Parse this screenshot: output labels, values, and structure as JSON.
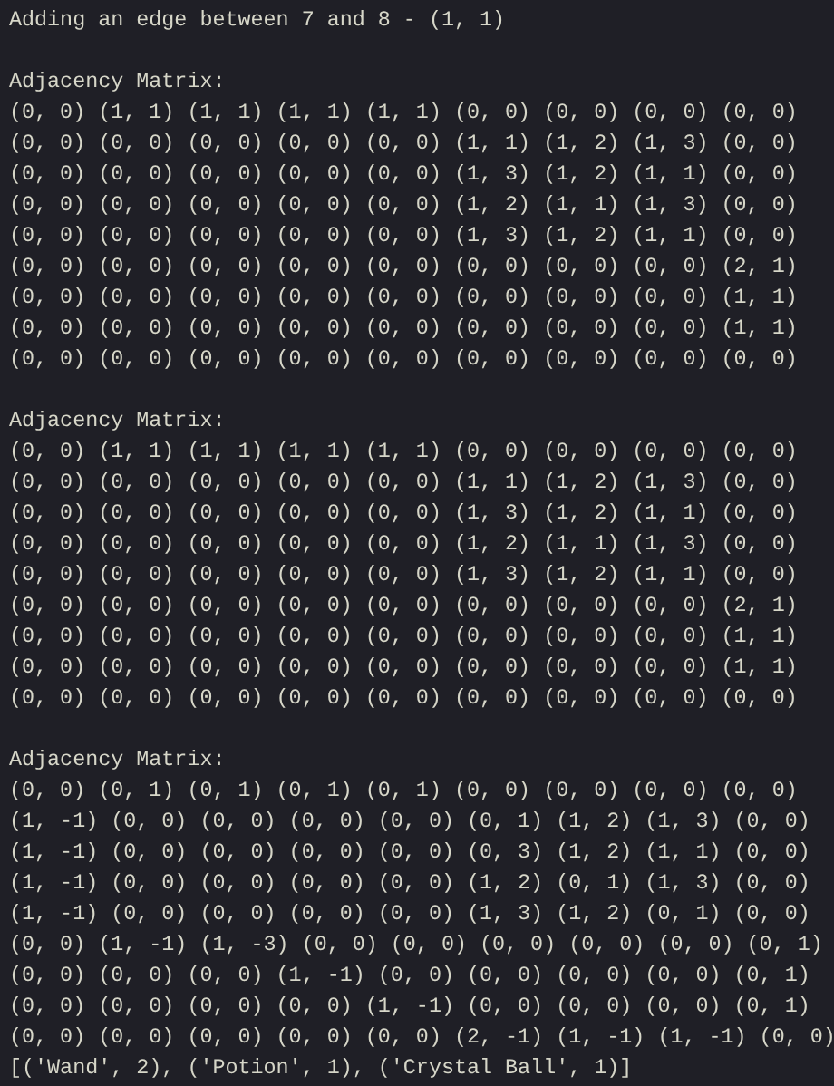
{
  "terminal": {
    "blocks": [
      {
        "kind": "line",
        "text": "Adding an edge between 7 and 8 - (1, 1)"
      },
      {
        "kind": "matrix",
        "title": "Adjacency Matrix:",
        "rows": [
          "(0, 0) (1, 1) (1, 1) (1, 1) (1, 1) (0, 0) (0, 0) (0, 0) (0, 0)",
          "(0, 0) (0, 0) (0, 0) (0, 0) (0, 0) (1, 1) (1, 2) (1, 3) (0, 0)",
          "(0, 0) (0, 0) (0, 0) (0, 0) (0, 0) (1, 3) (1, 2) (1, 1) (0, 0)",
          "(0, 0) (0, 0) (0, 0) (0, 0) (0, 0) (1, 2) (1, 1) (1, 3) (0, 0)",
          "(0, 0) (0, 0) (0, 0) (0, 0) (0, 0) (1, 3) (1, 2) (1, 1) (0, 0)",
          "(0, 0) (0, 0) (0, 0) (0, 0) (0, 0) (0, 0) (0, 0) (0, 0) (2, 1)",
          "(0, 0) (0, 0) (0, 0) (0, 0) (0, 0) (0, 0) (0, 0) (0, 0) (1, 1)",
          "(0, 0) (0, 0) (0, 0) (0, 0) (0, 0) (0, 0) (0, 0) (0, 0) (1, 1)",
          "(0, 0) (0, 0) (0, 0) (0, 0) (0, 0) (0, 0) (0, 0) (0, 0) (0, 0)"
        ]
      },
      {
        "kind": "matrix",
        "title": "Adjacency Matrix:",
        "rows": [
          "(0, 0) (1, 1) (1, 1) (1, 1) (1, 1) (0, 0) (0, 0) (0, 0) (0, 0)",
          "(0, 0) (0, 0) (0, 0) (0, 0) (0, 0) (1, 1) (1, 2) (1, 3) (0, 0)",
          "(0, 0) (0, 0) (0, 0) (0, 0) (0, 0) (1, 3) (1, 2) (1, 1) (0, 0)",
          "(0, 0) (0, 0) (0, 0) (0, 0) (0, 0) (1, 2) (1, 1) (1, 3) (0, 0)",
          "(0, 0) (0, 0) (0, 0) (0, 0) (0, 0) (1, 3) (1, 2) (1, 1) (0, 0)",
          "(0, 0) (0, 0) (0, 0) (0, 0) (0, 0) (0, 0) (0, 0) (0, 0) (2, 1)",
          "(0, 0) (0, 0) (0, 0) (0, 0) (0, 0) (0, 0) (0, 0) (0, 0) (1, 1)",
          "(0, 0) (0, 0) (0, 0) (0, 0) (0, 0) (0, 0) (0, 0) (0, 0) (1, 1)",
          "(0, 0) (0, 0) (0, 0) (0, 0) (0, 0) (0, 0) (0, 0) (0, 0) (0, 0)"
        ]
      },
      {
        "kind": "matrix",
        "title": "Adjacency Matrix:",
        "rows": [
          "(0, 0) (0, 1) (0, 1) (0, 1) (0, 1) (0, 0) (0, 0) (0, 0) (0, 0)",
          "(1, -1) (0, 0) (0, 0) (0, 0) (0, 0) (0, 1) (1, 2) (1, 3) (0, 0)",
          "(1, -1) (0, 0) (0, 0) (0, 0) (0, 0) (0, 3) (1, 2) (1, 1) (0, 0)",
          "(1, -1) (0, 0) (0, 0) (0, 0) (0, 0) (1, 2) (0, 1) (1, 3) (0, 0)",
          "(1, -1) (0, 0) (0, 0) (0, 0) (0, 0) (1, 3) (1, 2) (0, 1) (0, 0)",
          "(0, 0) (1, -1) (1, -3) (0, 0) (0, 0) (0, 0) (0, 0) (0, 0) (0, 1)",
          "(0, 0) (0, 0) (0, 0) (1, -1) (0, 0) (0, 0) (0, 0) (0, 0) (0, 1)",
          "(0, 0) (0, 0) (0, 0) (0, 0) (1, -1) (0, 0) (0, 0) (0, 0) (0, 1)",
          "(0, 0) (0, 0) (0, 0) (0, 0) (0, 0) (2, -1) (1, -1) (1, -1) (0, 0)"
        ]
      },
      {
        "kind": "tight",
        "text": "[('Wand', 2), ('Potion', 1), ('Crystal Ball', 1)]"
      }
    ]
  }
}
